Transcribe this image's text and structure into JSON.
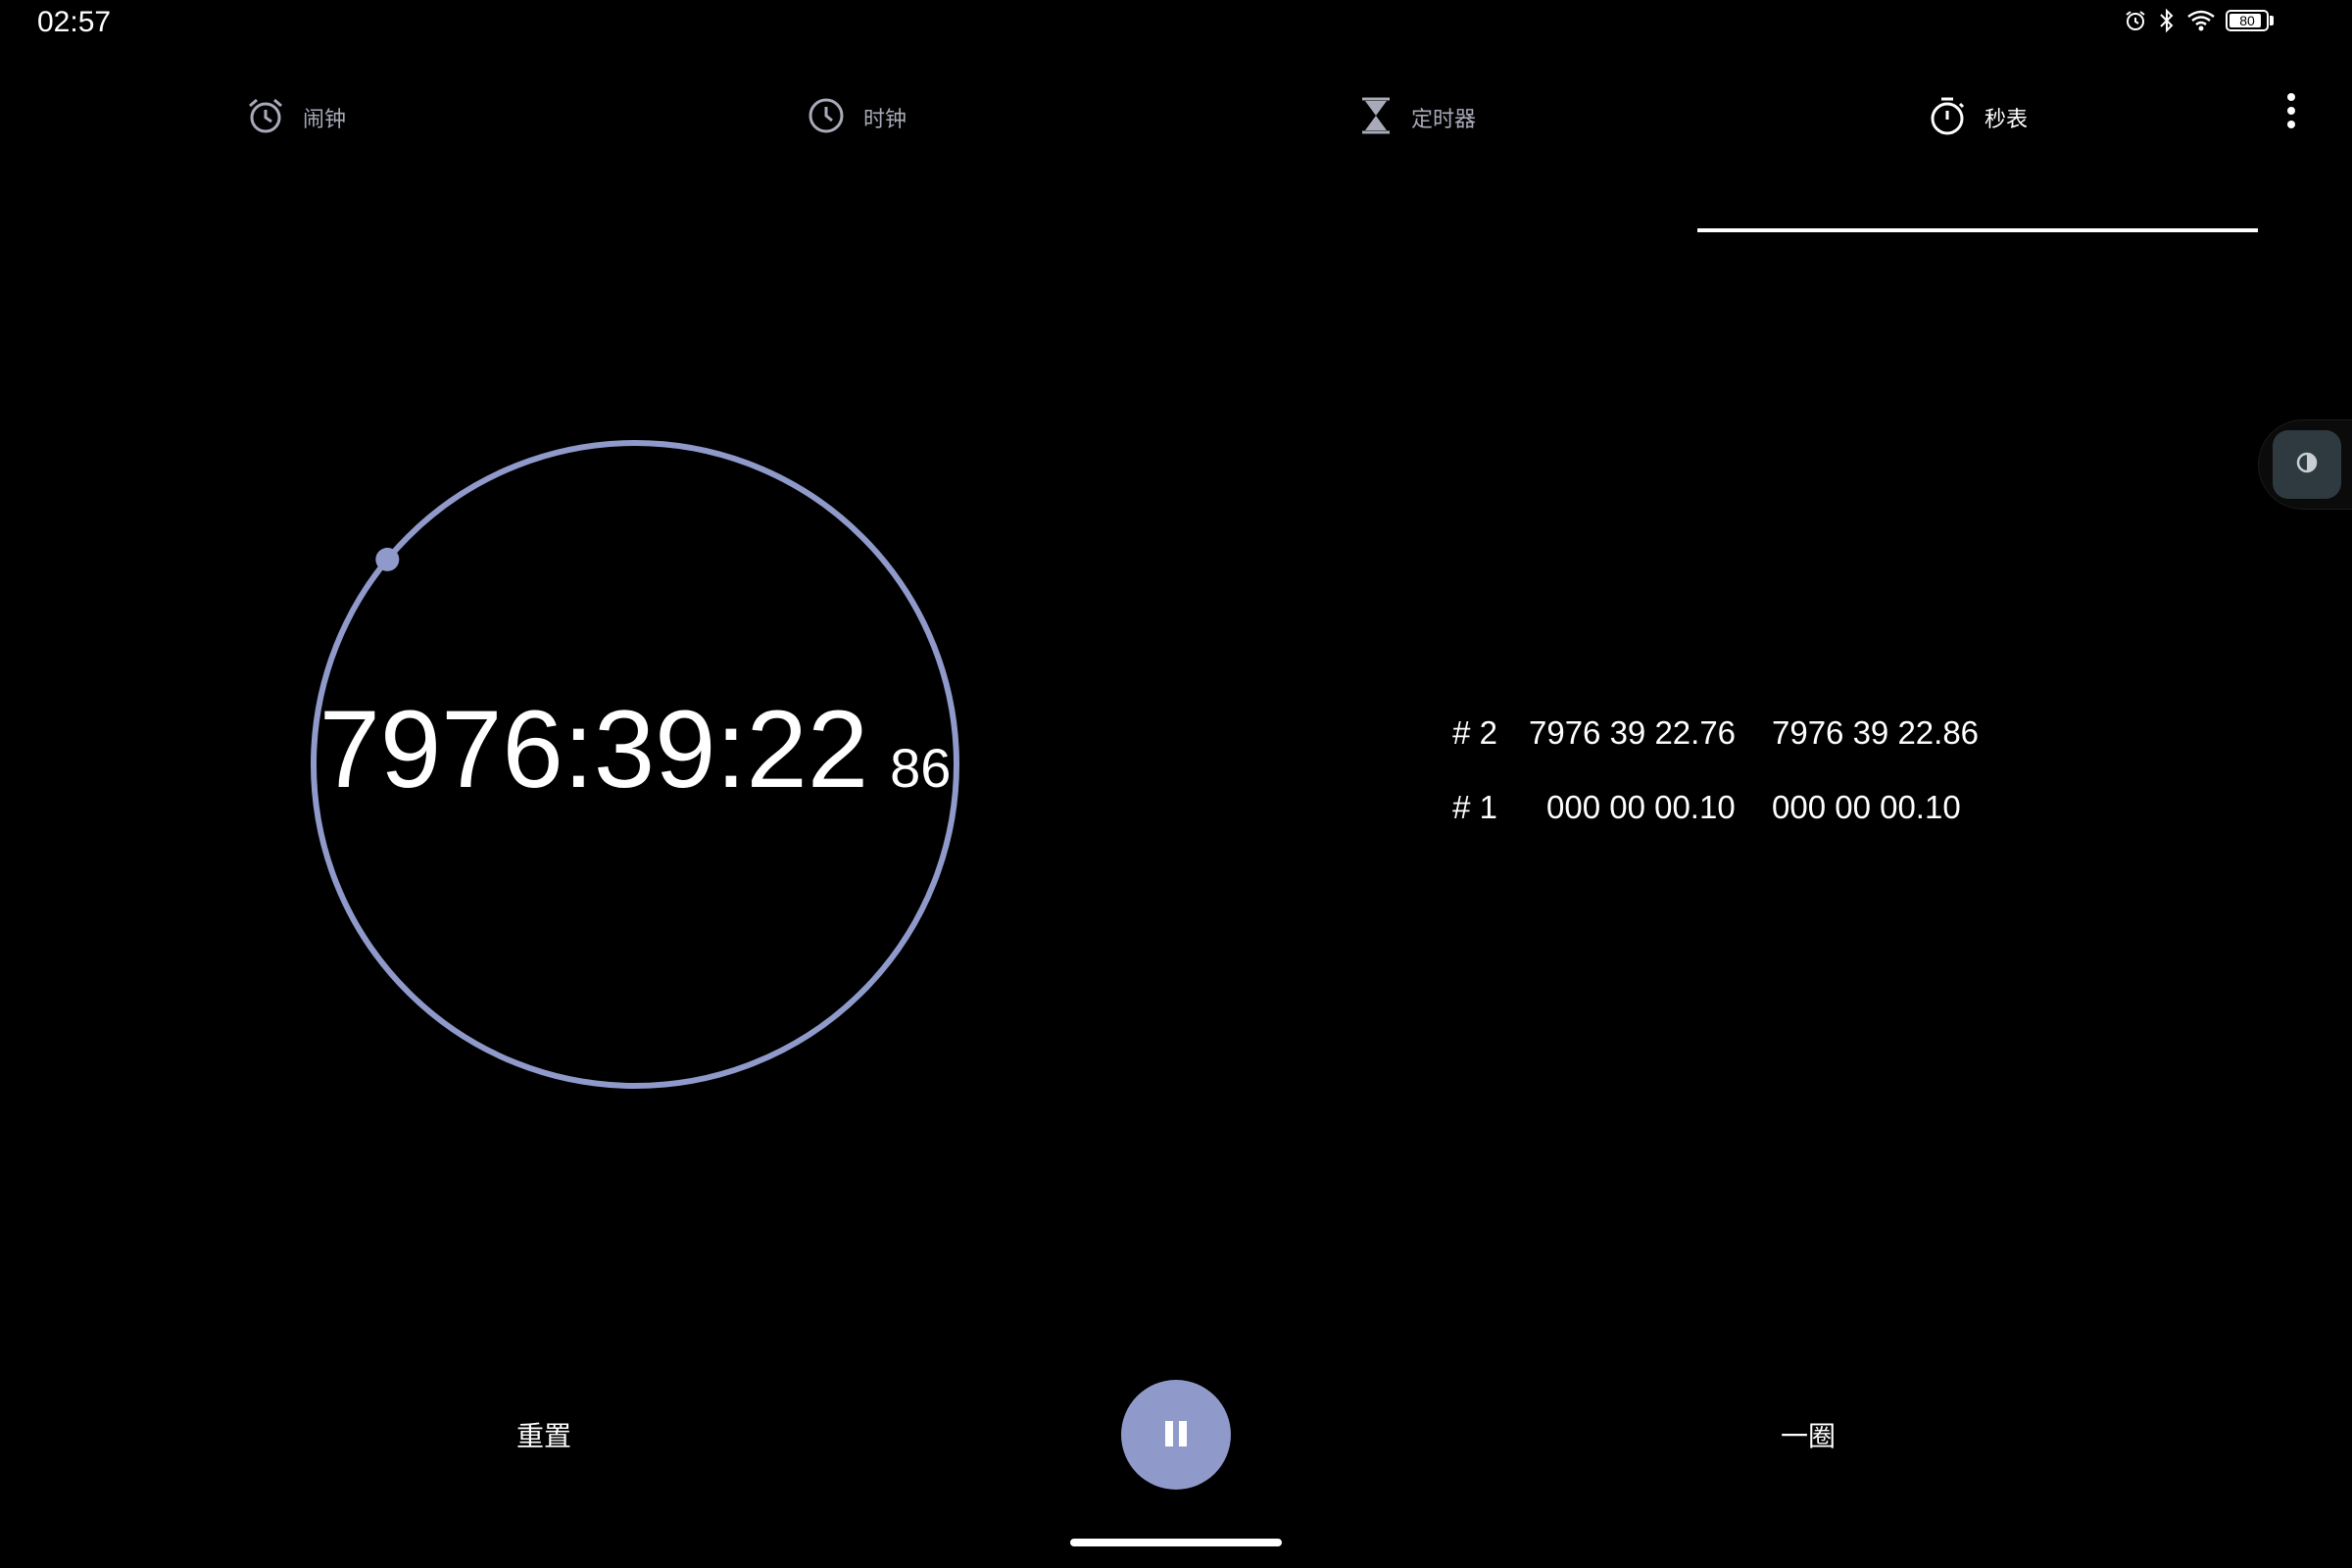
{
  "status_bar": {
    "time": "02:57",
    "icons": [
      "alarm-icon",
      "bluetooth-icon",
      "wifi-icon",
      "battery-icon"
    ],
    "battery_level": "80"
  },
  "tabs": [
    {
      "label": "闹钟",
      "icon": "alarm-clock-icon",
      "active": false
    },
    {
      "label": "时钟",
      "icon": "clock-icon",
      "active": false
    },
    {
      "label": "定时器",
      "icon": "hourglass-icon",
      "active": false
    },
    {
      "label": "秒表",
      "icon": "stopwatch-icon",
      "active": true
    }
  ],
  "stopwatch": {
    "time_main": "7976:39:22",
    "time_hundredths": "86",
    "progress_fraction": 0.86
  },
  "laps": [
    {
      "number": "# 2",
      "lap_time": "7976 39 22.76",
      "total_time": "7976 39 22.86"
    },
    {
      "number": "# 1",
      "lap_time": "000 00 00.10",
      "total_time": "000 00 00.10"
    }
  ],
  "controls": {
    "reset_label": "重置",
    "lap_label": "一圈",
    "pause_icon": "pause-icon"
  },
  "colors": {
    "accent": "#8f9acb",
    "background": "#000000",
    "tab_inactive": "#a8aab8",
    "side_button": "#2f3a40"
  }
}
